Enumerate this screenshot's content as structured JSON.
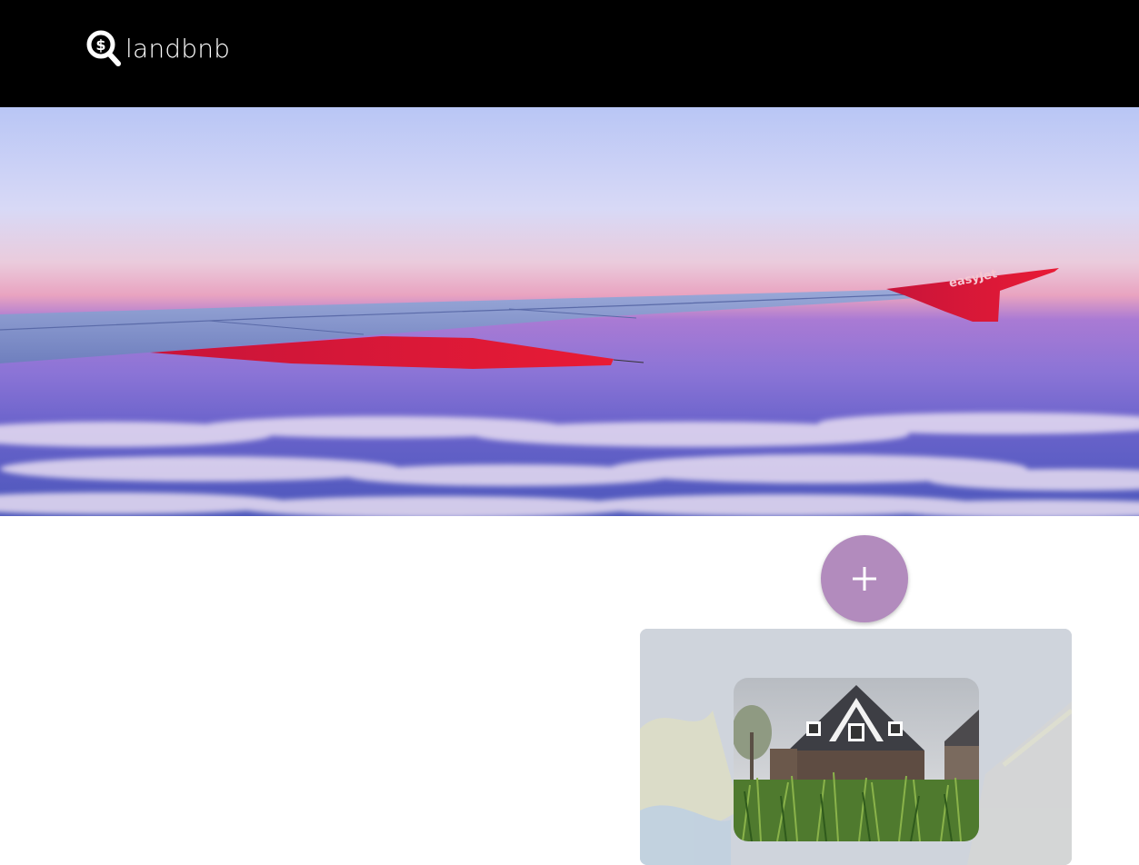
{
  "header": {
    "brand_name": "landbnb",
    "logo_icon": "search-dollar-icon",
    "background": "#000000"
  },
  "hero": {
    "image": "airplane-wing-sunset",
    "wing_text": "easyJet"
  },
  "add_button": {
    "icon": "plus-icon",
    "color": "#b28bbd"
  },
  "listing_card": {
    "image": "house-in-grass"
  }
}
